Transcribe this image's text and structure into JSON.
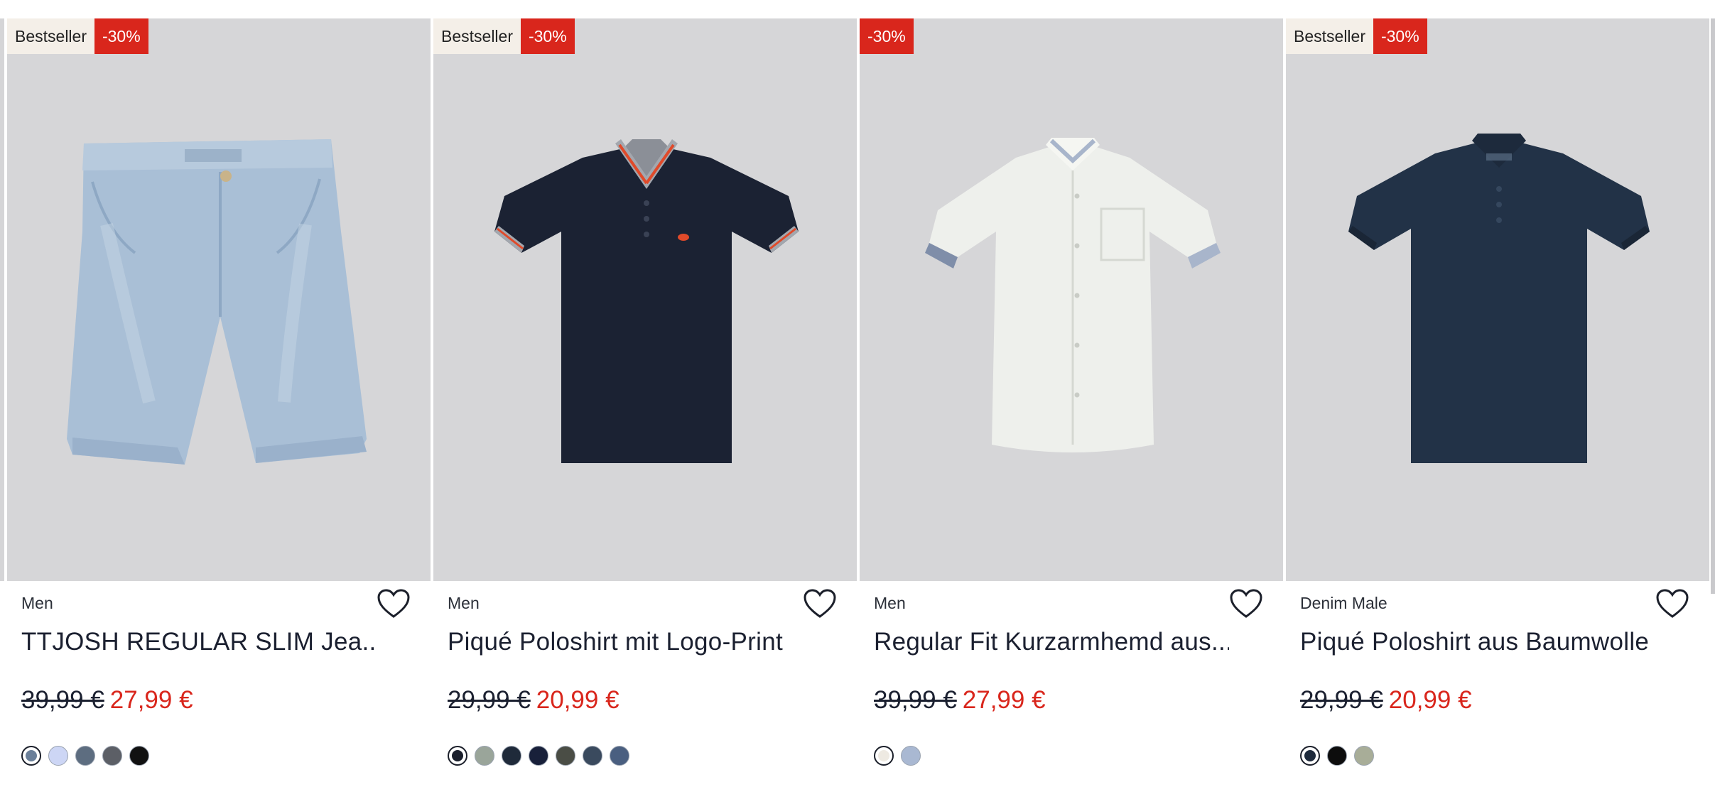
{
  "products": [
    {
      "badges": {
        "bestseller": "Bestseller",
        "discount": "-30%"
      },
      "brand": "Men",
      "title": "TTJOSH REGULAR SLIM Jea...",
      "price_old": "39,99 €",
      "price_new": "27,99 €",
      "image": "denim-shorts",
      "swatches": [
        "#6a7f99",
        "#cdd6f5",
        "#5d6d80",
        "#5c5f66",
        "#111111"
      ],
      "selected_swatch": 0
    },
    {
      "badges": {
        "bestseller": "Bestseller",
        "discount": "-30%"
      },
      "brand": "Men",
      "title": "Piqué Poloshirt mit Logo-Print",
      "price_old": "29,99 €",
      "price_new": "20,99 €",
      "image": "navy-polo-tipped",
      "swatches": [
        "#1a1f2c",
        "#9aa59a",
        "#1f2a3a",
        "#18203a",
        "#4a4d45",
        "#3a4a5e",
        "#4a5f80"
      ],
      "selected_swatch": 0
    },
    {
      "badges": {
        "discount": "-30%"
      },
      "brand": "Men",
      "title": "Regular Fit Kurzarmhemd aus...",
      "price_old": "39,99 €",
      "price_new": "27,99 €",
      "image": "white-shirt",
      "swatches": [
        "#eeeae2",
        "#a9b8d2"
      ],
      "selected_swatch": 0
    },
    {
      "badges": {
        "bestseller": "Bestseller",
        "discount": "-30%"
      },
      "brand": "Denim Male",
      "title": "Piqué Poloshirt aus Baumwolle",
      "price_old": "29,99 €",
      "price_new": "20,99 €",
      "image": "navy-polo",
      "swatches": [
        "#1e2a3c",
        "#0d0d0d",
        "#a8ad98"
      ],
      "selected_swatch": 0
    }
  ]
}
